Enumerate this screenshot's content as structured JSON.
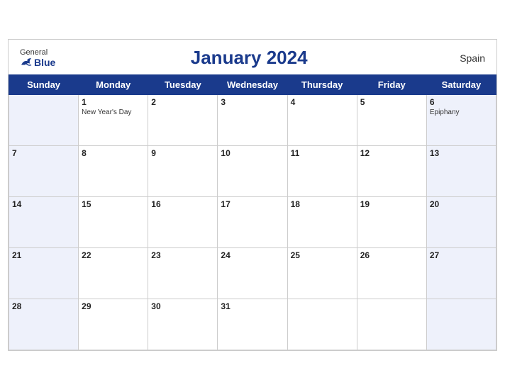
{
  "header": {
    "logo_general": "General",
    "logo_blue": "Blue",
    "title": "January 2024",
    "country": "Spain"
  },
  "weekdays": [
    "Sunday",
    "Monday",
    "Tuesday",
    "Wednesday",
    "Thursday",
    "Friday",
    "Saturday"
  ],
  "weeks": [
    [
      {
        "day": "",
        "event": ""
      },
      {
        "day": "1",
        "event": "New Year's Day"
      },
      {
        "day": "2",
        "event": ""
      },
      {
        "day": "3",
        "event": ""
      },
      {
        "day": "4",
        "event": ""
      },
      {
        "day": "5",
        "event": ""
      },
      {
        "day": "6",
        "event": "Epiphany"
      }
    ],
    [
      {
        "day": "7",
        "event": ""
      },
      {
        "day": "8",
        "event": ""
      },
      {
        "day": "9",
        "event": ""
      },
      {
        "day": "10",
        "event": ""
      },
      {
        "day": "11",
        "event": ""
      },
      {
        "day": "12",
        "event": ""
      },
      {
        "day": "13",
        "event": ""
      }
    ],
    [
      {
        "day": "14",
        "event": ""
      },
      {
        "day": "15",
        "event": ""
      },
      {
        "day": "16",
        "event": ""
      },
      {
        "day": "17",
        "event": ""
      },
      {
        "day": "18",
        "event": ""
      },
      {
        "day": "19",
        "event": ""
      },
      {
        "day": "20",
        "event": ""
      }
    ],
    [
      {
        "day": "21",
        "event": ""
      },
      {
        "day": "22",
        "event": ""
      },
      {
        "day": "23",
        "event": ""
      },
      {
        "day": "24",
        "event": ""
      },
      {
        "day": "25",
        "event": ""
      },
      {
        "day": "26",
        "event": ""
      },
      {
        "day": "27",
        "event": ""
      }
    ],
    [
      {
        "day": "28",
        "event": ""
      },
      {
        "day": "29",
        "event": ""
      },
      {
        "day": "30",
        "event": ""
      },
      {
        "day": "31",
        "event": ""
      },
      {
        "day": "",
        "event": ""
      },
      {
        "day": "",
        "event": ""
      },
      {
        "day": "",
        "event": ""
      }
    ]
  ],
  "colors": {
    "header_bg": "#1a3a8c",
    "header_text": "#ffffff",
    "title_color": "#1a3a8c"
  }
}
